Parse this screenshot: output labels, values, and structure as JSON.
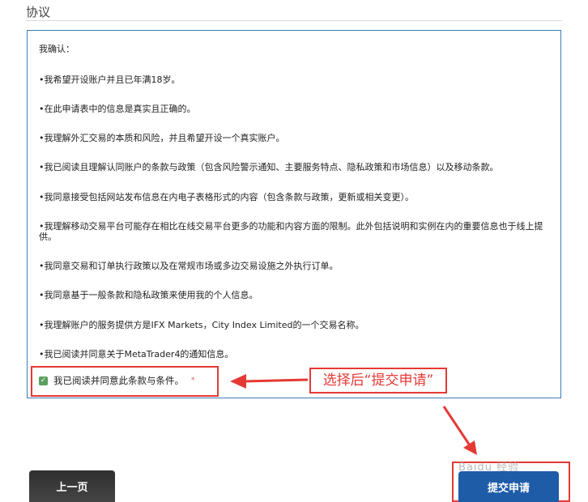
{
  "section_title": "协议",
  "agreement": {
    "intro": "我确认：",
    "items": [
      "•我希望开设账户并且已年满18岁。",
      "•在此申请表中的信息是真实且正确的。",
      "•我理解外汇交易的本质和风险，并且希望开设一个真实账户。",
      "•我已阅读且理解认同账户的条款与政策（包含风险警示通知、主要服务特点、隐私政策和市场信息）以及移动条款。",
      "•我同意接受包括网站发布信息在内电子表格形式的内容（包含条款与政策，更新或相关变更）。",
      "•我理解移动交易平台可能存在相比在线交易平台更多的功能和内容方面的限制。此外包括说明和实例在内的重要信息也于线上提供。",
      "•我同意交易和订单执行政策以及在常规市场或多边交易设施之外执行订单。",
      "•我同意基于一般条款和隐私政策来使用我的个人信息。",
      "•我理解账户的服务提供方是IFX Markets，City Index Limited的一个交易名称。",
      "•我已阅读并同意关于MetaTrader4的通知信息。"
    ],
    "checkbox_label": "我已阅读并同意此条款与条件。",
    "required_mark": "*"
  },
  "annotation": {
    "callout_text": "选择后“提交申请”",
    "accent_color": "#e53935"
  },
  "buttons": {
    "prev_label": "上一页",
    "submit_label": "提交申请"
  },
  "watermark_text": "Baidu 经验"
}
